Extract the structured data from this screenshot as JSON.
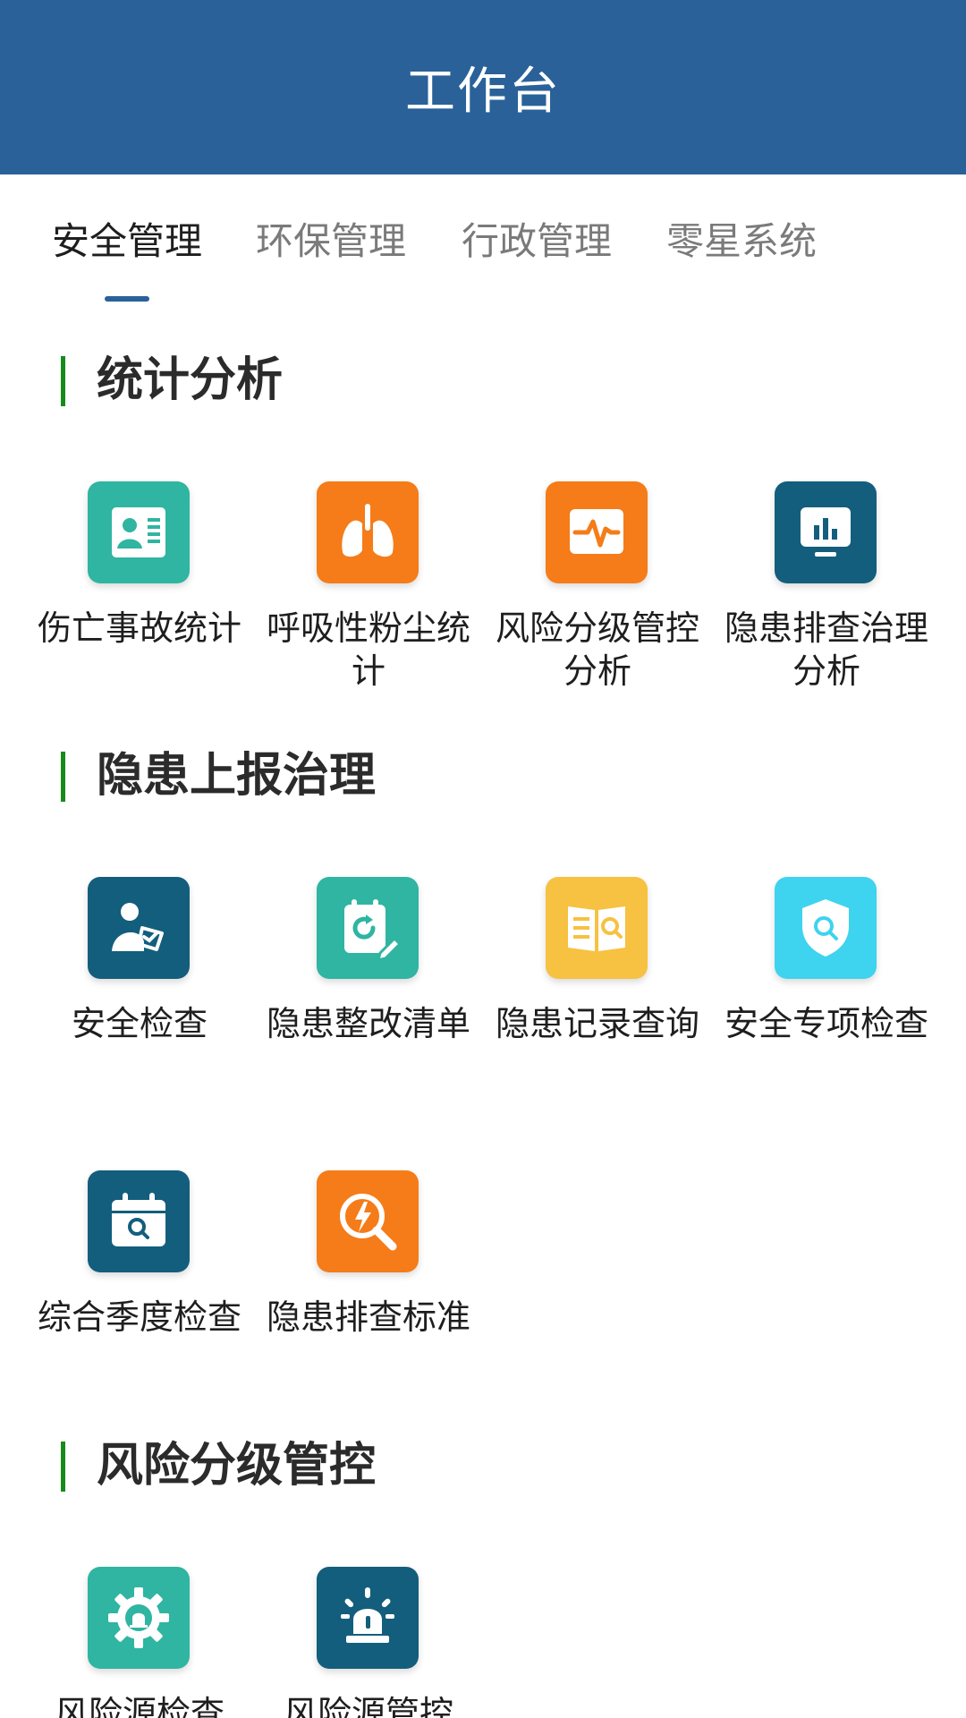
{
  "header": {
    "title": "工作台",
    "background": "#2a6199"
  },
  "tabs": [
    {
      "label": "安全管理",
      "active": true
    },
    {
      "label": "环保管理",
      "active": false
    },
    {
      "label": "行政管理",
      "active": false
    },
    {
      "label": "零星系统",
      "active": false
    }
  ],
  "sections": [
    {
      "title": "统计分析",
      "items": [
        {
          "label": "伤亡事故统计",
          "icon": "id-card-icon",
          "color": "#2fb5a1"
        },
        {
          "label": "呼吸性粉尘统计",
          "icon": "lungs-icon",
          "color": "#f57c18"
        },
        {
          "label": "风险分级管控分析",
          "icon": "pulse-monitor-icon",
          "color": "#f57c18"
        },
        {
          "label": "隐患排查治理分析",
          "icon": "bar-chart-monitor-icon",
          "color": "#135e7c"
        }
      ]
    },
    {
      "title": "隐患上报治理",
      "items": [
        {
          "label": "安全检查",
          "icon": "inspector-clipboard-icon",
          "color": "#135e7c"
        },
        {
          "label": "隐患整改清单",
          "icon": "refresh-clipboard-icon",
          "color": "#2fb5a1"
        },
        {
          "label": "隐患记录查询",
          "icon": "book-search-icon",
          "color": "#f7c141"
        },
        {
          "label": "安全专项检查",
          "icon": "shield-search-icon",
          "color": "#3ed3ef"
        },
        {
          "label": "综合季度检查",
          "icon": "calendar-search-icon",
          "color": "#135e7c"
        },
        {
          "label": "隐患排查标准",
          "icon": "lightning-search-icon",
          "color": "#f57c18"
        }
      ]
    },
    {
      "title": "风险分级管控",
      "items": [
        {
          "label": "风险源检查",
          "icon": "gear-alarm-icon",
          "color": "#2fb5a1"
        },
        {
          "label": "风险源管控",
          "icon": "siren-icon",
          "color": "#135e7c"
        }
      ]
    }
  ]
}
